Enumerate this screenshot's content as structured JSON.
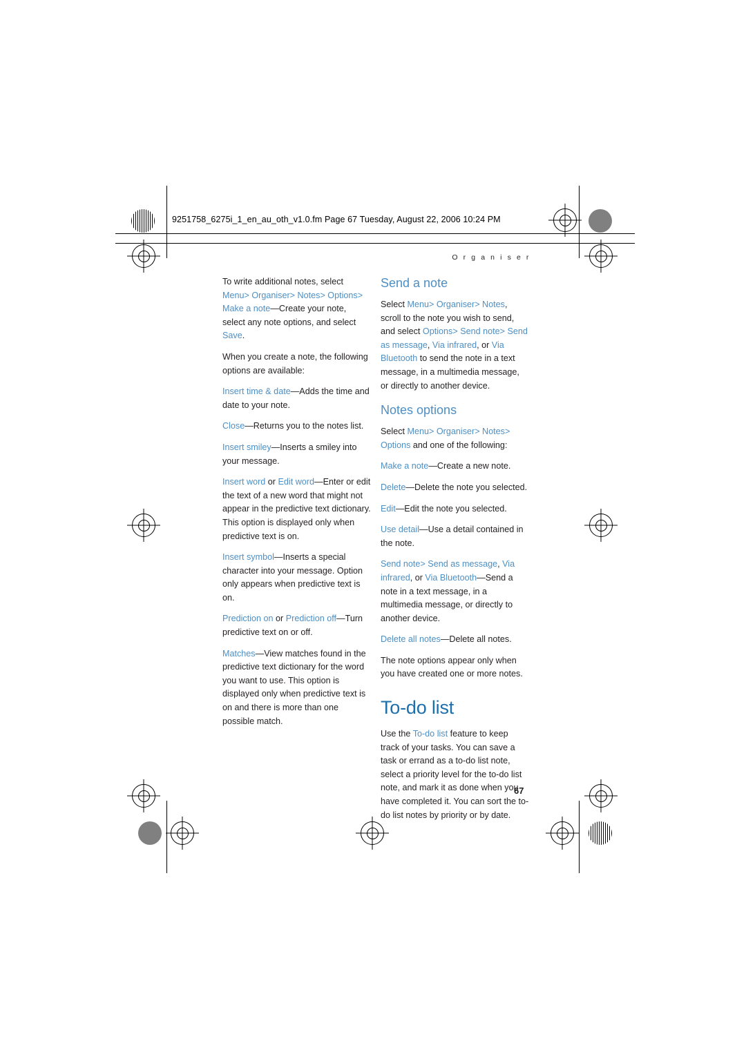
{
  "page": {
    "file_header": "9251758_6275i_1_en_au_oth_v1.0.fm  Page 67  Tuesday, August 22, 2006  10:24 PM",
    "running_head": "O r g a n i s e r",
    "page_number": "67",
    "accent_color": "#4d8fc4",
    "heading_color": "#1d6fab",
    "text_color": "#231f20"
  },
  "left_column": {
    "paragraphs": [
      {
        "id": "p-write-additional",
        "parts": [
          {
            "text": "To write additional notes, select ",
            "style": "plain"
          },
          {
            "text": "Menu",
            "style": "ui"
          },
          {
            "text": "> ",
            "style": "ui"
          },
          {
            "text": "Organiser",
            "style": "ui"
          },
          {
            "text": "> ",
            "style": "ui"
          },
          {
            "text": "Notes",
            "style": "ui"
          },
          {
            "text": "> ",
            "style": "ui"
          },
          {
            "text": "Options",
            "style": "ui"
          },
          {
            "text": "> ",
            "style": "ui"
          },
          {
            "text": "Make a note",
            "style": "ui"
          },
          {
            "text": "—Create your note, select any note options, and select ",
            "style": "plain"
          },
          {
            "text": "Save",
            "style": "ui"
          },
          {
            "text": ".",
            "style": "plain"
          }
        ]
      },
      {
        "id": "p-when-create",
        "parts": [
          {
            "text": "When you create a note, the following options are available:",
            "style": "plain"
          }
        ]
      },
      {
        "id": "p-insert-time-date",
        "parts": [
          {
            "text": "Insert time & date",
            "style": "ui"
          },
          {
            "text": "—Adds the time and date to your note.",
            "style": "plain"
          }
        ]
      },
      {
        "id": "p-close",
        "parts": [
          {
            "text": "Close",
            "style": "ui"
          },
          {
            "text": "—Returns you to the notes list.",
            "style": "plain"
          }
        ]
      },
      {
        "id": "p-insert-smiley",
        "parts": [
          {
            "text": "Insert smiley",
            "style": "ui"
          },
          {
            "text": "—Inserts a smiley into your message.",
            "style": "plain"
          }
        ]
      },
      {
        "id": "p-insert-word",
        "parts": [
          {
            "text": "Insert word",
            "style": "ui"
          },
          {
            "text": " or ",
            "style": "plain"
          },
          {
            "text": "Edit word",
            "style": "ui"
          },
          {
            "text": "—Enter or edit the text of a new word that might not appear in the predictive text dictionary. This option is displayed only when predictive text is on.",
            "style": "plain"
          }
        ]
      },
      {
        "id": "p-insert-symbol",
        "parts": [
          {
            "text": "Insert symbol",
            "style": "ui"
          },
          {
            "text": "—Inserts a special character into your message. Option only appears when predictive text is on.",
            "style": "plain"
          }
        ]
      },
      {
        "id": "p-prediction",
        "parts": [
          {
            "text": "Prediction on",
            "style": "ui"
          },
          {
            "text": " or ",
            "style": "plain"
          },
          {
            "text": "Prediction off",
            "style": "ui"
          },
          {
            "text": "—Turn predictive text on or off.",
            "style": "plain"
          }
        ]
      },
      {
        "id": "p-matches",
        "parts": [
          {
            "text": "Matches",
            "style": "ui"
          },
          {
            "text": "—View matches found in the predictive text dictionary for the word you want to use. This option is displayed only when predictive text is on and there is more than one possible match.",
            "style": "plain"
          }
        ]
      }
    ]
  },
  "right_column": {
    "headings": {
      "send_a_note": "Send a note",
      "notes_options": "Notes options",
      "to_do_list": "To-do list"
    },
    "paragraphs_send": [
      {
        "id": "p-send-note-body",
        "parts": [
          {
            "text": "Select ",
            "style": "plain"
          },
          {
            "text": "Menu",
            "style": "ui"
          },
          {
            "text": "> ",
            "style": "ui"
          },
          {
            "text": "Organiser",
            "style": "ui"
          },
          {
            "text": "> ",
            "style": "ui"
          },
          {
            "text": "Notes",
            "style": "ui"
          },
          {
            "text": ", scroll to the note you wish to send, and select ",
            "style": "plain"
          },
          {
            "text": "Options",
            "style": "ui"
          },
          {
            "text": "> ",
            "style": "ui"
          },
          {
            "text": "Send note",
            "style": "ui"
          },
          {
            "text": "> ",
            "style": "ui"
          },
          {
            "text": "Send as message",
            "style": "ui"
          },
          {
            "text": ", ",
            "style": "plain"
          },
          {
            "text": "Via infrared",
            "style": "ui"
          },
          {
            "text": ", or ",
            "style": "plain"
          },
          {
            "text": "Via Bluetooth",
            "style": "ui"
          },
          {
            "text": " to send the note in a text message, in a multimedia message, or directly to another device.",
            "style": "plain"
          }
        ]
      }
    ],
    "paragraphs_options": [
      {
        "id": "p-notes-options-intro",
        "parts": [
          {
            "text": "Select ",
            "style": "plain"
          },
          {
            "text": "Menu",
            "style": "ui"
          },
          {
            "text": "> ",
            "style": "ui"
          },
          {
            "text": "Organiser",
            "style": "ui"
          },
          {
            "text": "> ",
            "style": "ui"
          },
          {
            "text": "Notes",
            "style": "ui"
          },
          {
            "text": "> ",
            "style": "ui"
          },
          {
            "text": "Options",
            "style": "ui"
          },
          {
            "text": " and one of the following:",
            "style": "plain"
          }
        ]
      },
      {
        "id": "p-make-a-note",
        "parts": [
          {
            "text": "Make a note",
            "style": "ui"
          },
          {
            "text": "—Create a new note.",
            "style": "plain"
          }
        ]
      },
      {
        "id": "p-delete",
        "parts": [
          {
            "text": "Delete",
            "style": "ui"
          },
          {
            "text": "—Delete the note you selected.",
            "style": "plain"
          }
        ]
      },
      {
        "id": "p-edit",
        "parts": [
          {
            "text": "Edit",
            "style": "ui"
          },
          {
            "text": "—Edit the note you selected.",
            "style": "plain"
          }
        ]
      },
      {
        "id": "p-use-detail",
        "parts": [
          {
            "text": "Use detail",
            "style": "ui"
          },
          {
            "text": "—Use a detail contained in the note.",
            "style": "plain"
          }
        ]
      },
      {
        "id": "p-send-note-option",
        "parts": [
          {
            "text": "Send note",
            "style": "ui"
          },
          {
            "text": "> ",
            "style": "ui"
          },
          {
            "text": "Send as message",
            "style": "ui"
          },
          {
            "text": ", ",
            "style": "plain"
          },
          {
            "text": "Via infrared",
            "style": "ui"
          },
          {
            "text": ", or ",
            "style": "plain"
          },
          {
            "text": "Via Bluetooth",
            "style": "ui"
          },
          {
            "text": "—Send a note in a text message, in a multimedia message, or directly to another device.",
            "style": "plain"
          }
        ]
      },
      {
        "id": "p-delete-all-notes",
        "parts": [
          {
            "text": "Delete all notes",
            "style": "ui"
          },
          {
            "text": "—Delete all notes.",
            "style": "plain"
          }
        ]
      },
      {
        "id": "p-note-options-appear",
        "parts": [
          {
            "text": "The note options appear only when you have created one or more notes.",
            "style": "plain"
          }
        ]
      }
    ],
    "paragraphs_todo": [
      {
        "id": "p-todo-body",
        "parts": [
          {
            "text": "Use the ",
            "style": "plain"
          },
          {
            "text": "To-do list",
            "style": "ui"
          },
          {
            "text": " feature to keep track of your tasks. You can save a task or errand as a to-do list note, select a priority level for the to-do list note, and mark it as done when you have completed it. You can sort the to-do list notes by priority or by date.",
            "style": "plain"
          }
        ]
      }
    ]
  }
}
